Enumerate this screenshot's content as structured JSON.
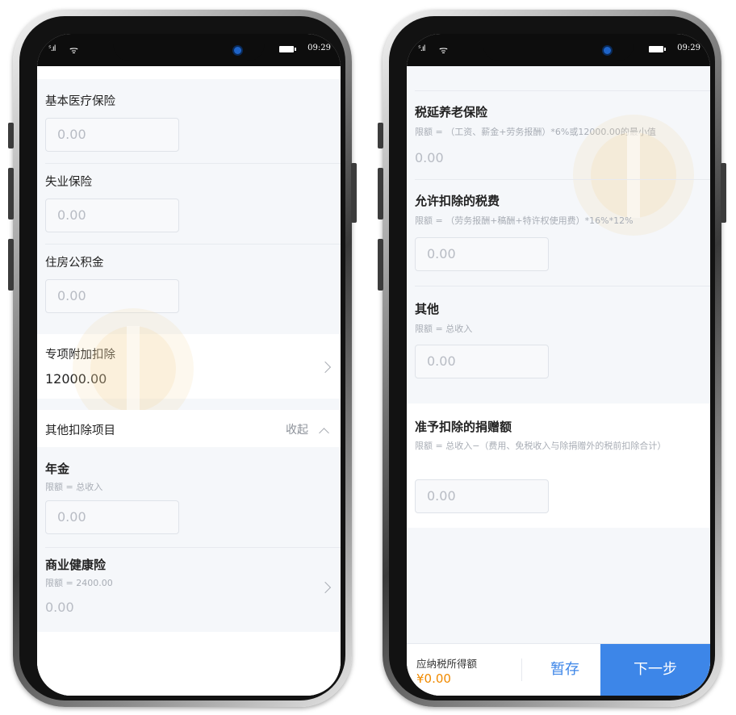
{
  "status_bar": {
    "time": "09:29",
    "signal": "ˢ.ıl",
    "wifi": "ᯤ"
  },
  "left": {
    "medical": {
      "label": "基本医疗保险",
      "value": "0.00"
    },
    "unemployment": {
      "label": "失业保险",
      "value": "0.00"
    },
    "housing_fund": {
      "label": "住房公积金",
      "value": "0.00"
    },
    "special_deduction": {
      "label": "专项附加扣除",
      "value": "12000.00"
    },
    "other_items": {
      "label": "其他扣除项目",
      "collapse_label": "收起"
    },
    "annuity": {
      "label": "年金",
      "hint": "限额 = 总收入",
      "value": "0.00"
    },
    "health_insurance": {
      "label": "商业健康险",
      "hint": "限额 = 2400.00",
      "value": "0.00"
    }
  },
  "right": {
    "pension": {
      "label": "税延养老保险",
      "hint": "限额 = （工资、薪金+劳务报酬）*6%或12000.00的最小值",
      "value": "0.00"
    },
    "allowed_tax": {
      "label": "允许扣除的税费",
      "hint": "限额 = （劳务报酬+稿酬+特许权使用费）*16%*12%",
      "value": "0.00"
    },
    "other": {
      "label": "其他",
      "hint": "限额 = 总收入",
      "value": "0.00"
    },
    "donation": {
      "label": "准予扣除的捐赠额",
      "hint": "限额 = 总收入−（费用、免税收入与除捐赠外的税前扣除合计）",
      "value": "0.00"
    },
    "bottom_bar": {
      "taxable_label": "应纳税所得额",
      "taxable_amount": "¥0.00",
      "save_label": "暂存",
      "next_label": "下一步"
    }
  },
  "colors": {
    "primary": "#3d86e8",
    "amount": "#f08a00",
    "background": "#f5f7fa"
  }
}
